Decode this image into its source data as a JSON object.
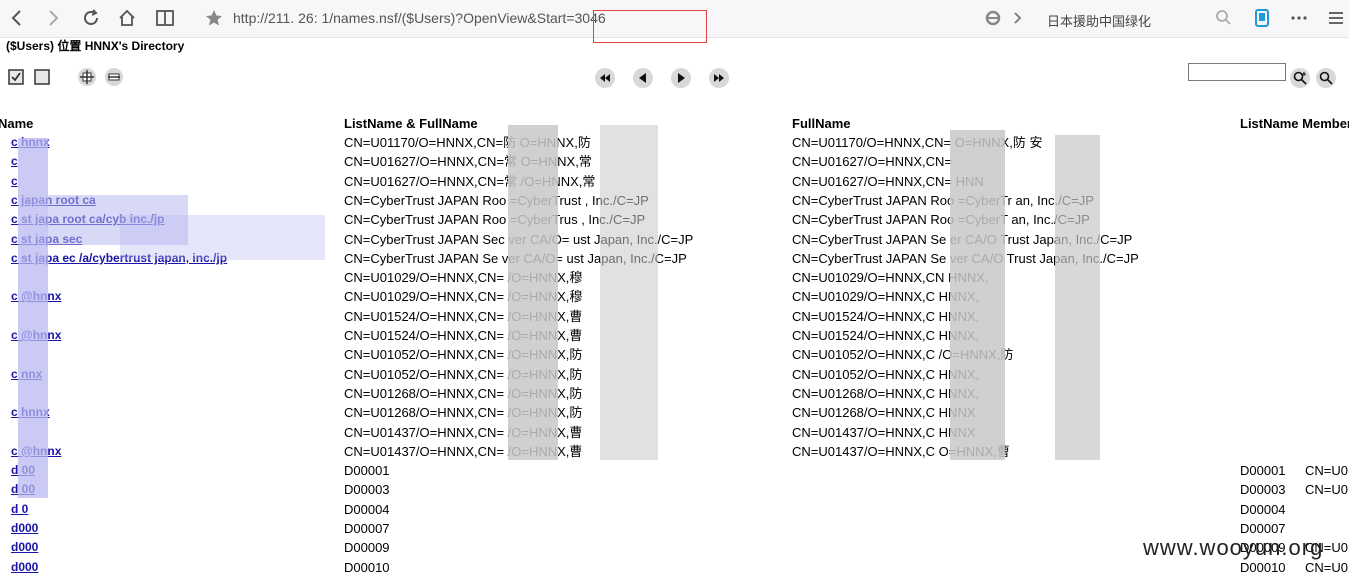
{
  "browser": {
    "address": "http://211.          26:      1/names.nsf/($Users)?OpenView&Start=3046",
    "search_text": "日本援助中国绿化"
  },
  "page": {
    "title": "($Users) 位置 HNNX's Directory",
    "columns": {
      "name": "Name",
      "list_full": "ListName & FullName",
      "full": "FullName",
      "member": "ListName Members"
    }
  },
  "rows": [
    {
      "name": "c    hnnx",
      "list": "CN=U01170/O=HNNX,CN=防    O=HNNX,防",
      "full": "CN=U01170/O=HNNX,CN=    O=HNNX,防 安",
      "member": "",
      "member2": ""
    },
    {
      "name": "c",
      "list": "CN=U01627/O=HNNX,CN=常    O=HNNX,常",
      "full": "CN=U01627/O=HNNX,CN=",
      "member": "",
      "member2": ""
    },
    {
      "name": "c",
      "list": "CN=U01627/O=HNNX,CN=常    /O=HNNX,常",
      "full": "CN=U01627/O=HNNX,CN=    HNN",
      "member": "",
      "member2": ""
    },
    {
      "name": "c     japan root ca",
      "list": "CN=CyberTrust JAPAN Roo    =CyberTrust    , Inc./C=JP",
      "full": "CN=CyberTrust JAPAN Roo    =CyberTr    an, Inc./C=JP",
      "member": "",
      "member2": ""
    },
    {
      "name": "c    st japa    root ca/cyb     inc./jp",
      "list": "CN=CyberTrust JAPAN Roo    =CyberTrus    , Inc./C=JP",
      "full": "CN=CyberTrust JAPAN Roo    =CyberT    an, Inc./C=JP",
      "member": "",
      "member2": ""
    },
    {
      "name": "c    st japa    sec",
      "list": "CN=CyberTrust JAPAN Sec    ver CA/O=    ust Japan, Inc./C=JP",
      "full": "CN=CyberTrust JAPAN Se    er CA/O    Trust Japan, Inc./C=JP",
      "member": "",
      "member2": ""
    },
    {
      "name": "c    st japa    ec    /a/cybertrust japan, inc./jp",
      "list": "CN=CyberTrust JAPAN Se    ver CA/O=    ust Japan, Inc./C=JP",
      "full": "CN=CyberTrust JAPAN Se    ver CA/O    Trust Japan, Inc./C=JP",
      "member": "",
      "member2": ""
    },
    {
      "name": "",
      "list": "CN=U01029/O=HNNX,CN=    /O=HNNX,穆",
      "full": "CN=U01029/O=HNNX,CN    HNNX,",
      "member": "",
      "member2": ""
    },
    {
      "name": "c    @hnnx",
      "list": "CN=U01029/O=HNNX,CN=    /O=HNNX,穆",
      "full": "CN=U01029/O=HNNX,C    HNNX,",
      "member": "",
      "member2": ""
    },
    {
      "name": "",
      "list": "CN=U01524/O=HNNX,CN=    /O=HNNX,曹",
      "full": "CN=U01524/O=HNNX,C    HNNX,",
      "member": "",
      "member2": ""
    },
    {
      "name": "c    @hnnx",
      "list": "CN=U01524/O=HNNX,CN=    /O=HNNX,曹",
      "full": "CN=U01524/O=HNNX,C    HNNX,",
      "member": "",
      "member2": ""
    },
    {
      "name": "",
      "list": "CN=U01052/O=HNNX,CN=    /O=HNNX,防",
      "full": "CN=U01052/O=HNNX,C    /O=HNNX,防",
      "member": "",
      "member2": ""
    },
    {
      "name": "c    nnx",
      "list": "CN=U01052/O=HNNX,CN=    /O=HNNX,防",
      "full": "CN=U01052/O=HNNX,C    HNNX,",
      "member": "",
      "member2": ""
    },
    {
      "name": "",
      "list": "CN=U01268/O=HNNX,CN=    /O=HNNX,防",
      "full": "CN=U01268/O=HNNX,C    HNNX,",
      "member": "",
      "member2": ""
    },
    {
      "name": "c    hnnx",
      "list": "CN=U01268/O=HNNX,CN=    /O=HNNX,防",
      "full": "CN=U01268/O=HNNX,C    HNNX",
      "member": "",
      "member2": ""
    },
    {
      "name": "",
      "list": "CN=U01437/O=HNNX,CN=    /O=HNNX,曹",
      "full": "CN=U01437/O=HNNX,C    HNNX",
      "member": "",
      "member2": ""
    },
    {
      "name": "c    @hnnx",
      "list": "CN=U01437/O=HNNX,CN=    /O=HNNX,曹",
      "full": "CN=U01437/O=HNNX,C    O=HNNX,曹",
      "member": "",
      "member2": ""
    },
    {
      "name": "d    00",
      "list": "D00001",
      "full": "",
      "member": "D00001",
      "member2": "CN=U0"
    },
    {
      "name": "d    00",
      "list": "D00003",
      "full": "",
      "member": "D00003",
      "member2": "CN=U0"
    },
    {
      "name": "d    0",
      "list": "D00004",
      "full": "",
      "member": "D00004",
      "member2": ""
    },
    {
      "name": "d000",
      "list": "D00007",
      "full": "",
      "member": "D00007",
      "member2": ""
    },
    {
      "name": "d000",
      "list": "D00009",
      "full": "",
      "member": "D00009",
      "member2": "CN=U0"
    },
    {
      "name": "d000",
      "list": "D00010",
      "full": "",
      "member": "D00010",
      "member2": "CN=U0"
    }
  ],
  "watermark": "www.wooyun.org"
}
